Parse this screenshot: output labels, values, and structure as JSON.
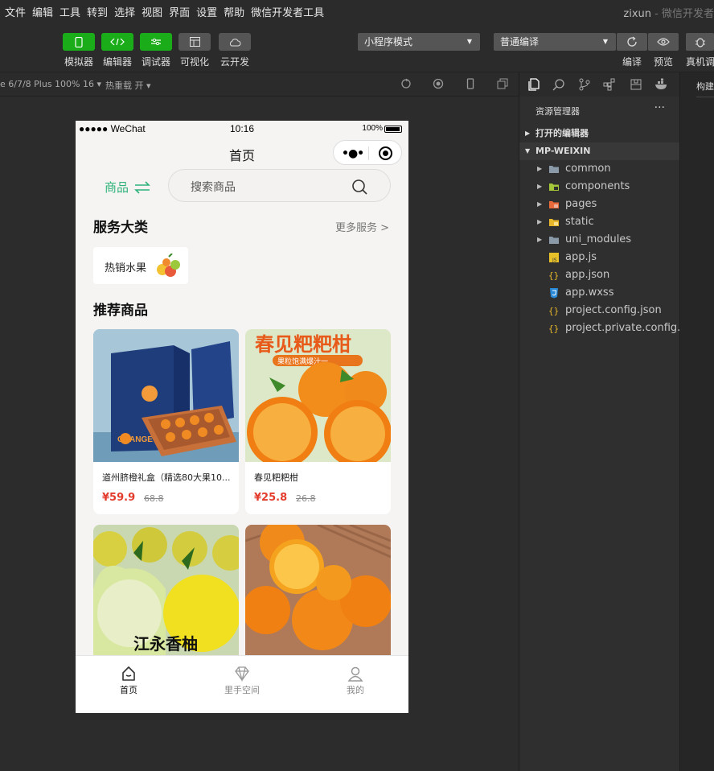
{
  "menu": [
    "文件",
    "编辑",
    "工具",
    "转到",
    "选择",
    "视图",
    "界面",
    "设置",
    "帮助",
    "微信开发者工具"
  ],
  "window": {
    "user": "zixun",
    "app_title": "- 微信开发者"
  },
  "toolbar": {
    "simulator": "模拟器",
    "editor": "编辑器",
    "debugger": "调试器",
    "visual": "可视化",
    "cloud": "云开发",
    "mode_select": "小程序模式",
    "compile_select": "普通编译",
    "compile": "编译",
    "preview": "预览",
    "realdebug": "真机调"
  },
  "subbar": {
    "device": "e 6/7/8 Plus 100% 16 ▾",
    "hotreload": "热重载 开 ▾"
  },
  "phone": {
    "status": {
      "carrier": "●●●●● WeChat",
      "time": "10:16",
      "battery": "100%"
    },
    "nav_title": "首页",
    "category_switch": "商品",
    "search_placeholder": "搜索商品",
    "services_title": "服务大类",
    "more_services": "更多服务 >",
    "chip_label": "热销水果",
    "recommend_title": "推荐商品",
    "products": [
      {
        "name": "道州脐橙礼盒（精选80大果10...",
        "price": "¥59.9",
        "orig": "68.8"
      },
      {
        "name": "春见粑粑柑",
        "price": "¥25.8",
        "orig": "26.8"
      },
      {
        "name": "",
        "price": "",
        "orig": ""
      },
      {
        "name": "",
        "price": "",
        "orig": ""
      }
    ],
    "img_text": {
      "p2_banner": "春见粑粑柑",
      "p2_sub": "果粒饱满爆汁一",
      "p3_text": "江永香柚",
      "p1_box": "ORANGE"
    },
    "tabs": [
      "首页",
      "里手空间",
      "我的"
    ]
  },
  "explorer": {
    "title": "资源管理器",
    "sections": [
      "打开的编辑器",
      "MP-WEIXIN"
    ],
    "items": [
      {
        "name": "common",
        "type": "folder"
      },
      {
        "name": "components",
        "type": "folder"
      },
      {
        "name": "pages",
        "type": "folder"
      },
      {
        "name": "static",
        "type": "folder"
      },
      {
        "name": "uni_modules",
        "type": "folder"
      },
      {
        "name": "app.js",
        "type": "js"
      },
      {
        "name": "app.json",
        "type": "json"
      },
      {
        "name": "app.wxss",
        "type": "css"
      },
      {
        "name": "project.config.json",
        "type": "json"
      },
      {
        "name": "project.private.config.js...",
        "type": "json"
      }
    ],
    "right_tab": "构建"
  },
  "colors": {
    "accent_green": "#1aad19",
    "teal": "#2fb27a",
    "price_red": "#e43c2c"
  }
}
